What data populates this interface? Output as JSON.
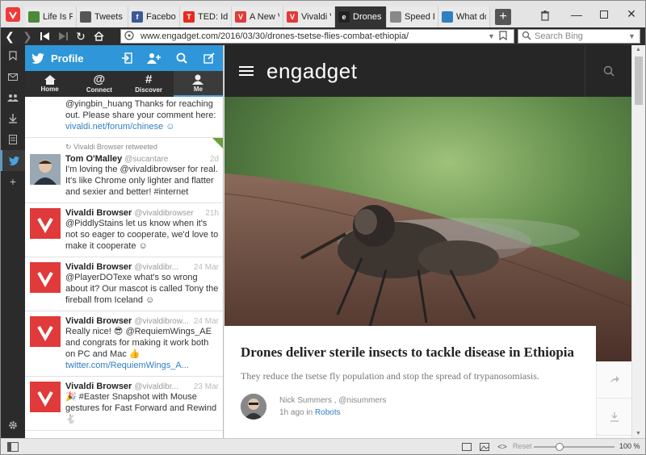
{
  "tabs": [
    {
      "title": "Life Is F",
      "favicon_color": "#4a8a3a",
      "favicon_text": ""
    },
    {
      "title": "Tweets",
      "favicon_color": "#555555",
      "favicon_text": ""
    },
    {
      "title": "Faceboo",
      "favicon_color": "#3b5998",
      "favicon_text": "f"
    },
    {
      "title": "TED: Ide",
      "favicon_color": "#e62b1e",
      "favicon_text": "T"
    },
    {
      "title": "A New V",
      "favicon_color": "#e03a3a",
      "favicon_text": "V"
    },
    {
      "title": "Vivaldi V",
      "favicon_color": "#e03a3a",
      "favicon_text": "V"
    },
    {
      "title": "Drones d",
      "favicon_color": "#222222",
      "favicon_text": "e"
    },
    {
      "title": "Speed D",
      "favicon_color": "#888888",
      "favicon_text": ""
    },
    {
      "title": "What do",
      "favicon_color": "#2f7fc1",
      "favicon_text": ""
    }
  ],
  "address": {
    "url": "www.engadget.com/2016/03/30/drones-tsetse-flies-combat-ethiopia/",
    "search_placeholder": "Search Bing"
  },
  "twitter": {
    "header_title": "Profile",
    "nav": [
      {
        "label": "Home"
      },
      {
        "label": "Connect"
      },
      {
        "label": "Discover"
      },
      {
        "label": "Me"
      }
    ],
    "tweets": [
      {
        "partial": true,
        "text": "@yingbin_huang Thanks for reaching out. Please share your comment here:",
        "link": "vivaldi.net/forum/chinese ☺"
      },
      {
        "retweet_note": "Vivaldi Browser retweeted",
        "name": "Tom O'Malley",
        "handle": "@sucantare",
        "time": "2d",
        "text": "I'm loving the @vivaldibrowser for real. It's like Chrome only lighter and flatter and sexier and better! #internet",
        "avatar": "person"
      },
      {
        "name": "Vivaldi Browser",
        "handle": "@vivaldibrowser",
        "time": "21h",
        "text": "@PiddlyStains let us know when it's not so eager to cooperate, we'd love to make it cooperate ☺",
        "avatar": "vivaldi"
      },
      {
        "name": "Vivaldi Browser",
        "handle": "@vivaldibr...",
        "time": "24 Mar",
        "text": "@PlayerDOTexe what's so wrong about it? Our mascot is called Tony the fireball from Iceland ☺",
        "avatar": "vivaldi"
      },
      {
        "name": "Vivaldi Browser",
        "handle": "@vivaldibrow...",
        "time": "24 Mar",
        "text": "Really nice! 😎 @RequiemWings_AE and congrats for making it work both on PC and Mac 👍",
        "link": "twitter.com/RequiemWings_A...",
        "avatar": "vivaldi"
      },
      {
        "name": "Vivaldi Browser",
        "handle": "@vivaldibr...",
        "time": "23 Mar",
        "text": "🎉 #Easter Snapshot with Mouse gestures for Fast Forward and Rewind 🐇",
        "avatar": "vivaldi"
      }
    ]
  },
  "article": {
    "site_logo": "engadget",
    "headline": "Drones deliver sterile insects to tackle disease in Ethiopia",
    "dek": "They reduce the tsetse fly population and stop the spread of trypanosomiasis.",
    "author": "Nick Summers",
    "author_handle": "@nisummers",
    "author_sep": " , ",
    "time_ago": "1h ago in",
    "category": "Robots"
  },
  "status": {
    "reset_label": "Reset",
    "zoom": "100 %",
    "zoom_fraction": 0.3
  },
  "colors": {
    "vivaldi_red": "#ef3939",
    "twitter_blue": "#2f96d9",
    "link_blue": "#2f7fc1"
  }
}
